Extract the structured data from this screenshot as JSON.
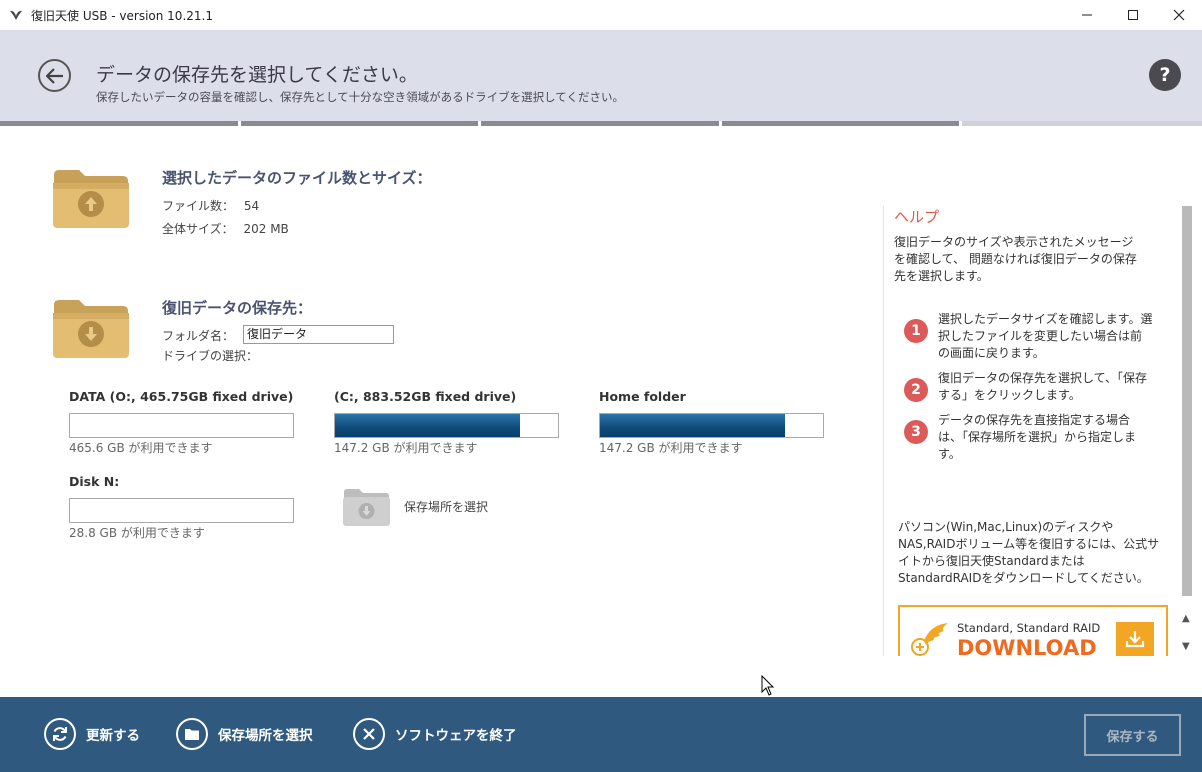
{
  "window": {
    "title": "復旧天使 USB - version 10.21.1"
  },
  "header": {
    "title": "データの保存先を選択してください。",
    "subtitle": "保存したいデータの容量を確認し、保存先として十分な空き領域があるドライブを選択してください。",
    "help_label": "?"
  },
  "selected": {
    "title": "選択したデータのファイル数とサイズ：",
    "file_count_label": "ファイル数：",
    "file_count_value": "54",
    "total_size_label": "全体サイズ：",
    "total_size_value": "202 MB"
  },
  "destination": {
    "title": "復旧データの保存先：",
    "folder_label": "フォルダ名：",
    "folder_value": "復旧データ",
    "drive_label": "ドライブの選択："
  },
  "drives": [
    {
      "name": "DATA (O:, 465.75GB fixed drive)",
      "used_fraction": 0.0,
      "free": "465.6 GB が利用できます"
    },
    {
      "name": " (C:, 883.52GB fixed drive)",
      "used_fraction": 0.83,
      "free": "147.2 GB が利用できます"
    },
    {
      "name": "Home folder",
      "used_fraction": 0.83,
      "free": "147.2 GB が利用できます"
    },
    {
      "name": "Disk N:",
      "used_fraction": 0.0,
      "free": "28.8 GB が利用できます"
    }
  ],
  "choose_location": {
    "label": "保存場所を選択"
  },
  "help": {
    "title": "ヘルプ",
    "intro": "復旧データのサイズや表示されたメッセージを確認して、 問題なければ復旧データの保存先を選択します。",
    "steps": [
      {
        "num": "1",
        "text": "選択したデータサイズを確認します。選択したファイルを変更したい場合は前の画面に戻ります。"
      },
      {
        "num": "2",
        "text": "復旧データの保存先を選択して、「保存する」をクリックします。"
      },
      {
        "num": "3",
        "text": "データの保存先を直接指定する場合は、「保存場所を選択」から指定します。"
      }
    ],
    "note": "パソコン(Win,Mac,Linux)のディスクやNAS,RAIDボリューム等を復旧するには、公式サイトから復旧天使StandardまたはStandardRAIDをダウンロードしてください。",
    "banner_line1": "Standard, Standard RAID",
    "banner_line2": "DOWNLOAD"
  },
  "footer": {
    "refresh_label": "更新する",
    "choose_label": "保存場所を選択",
    "exit_label": "ソフトウェアを終了",
    "save_label": "保存する"
  },
  "colors": {
    "accent": "#30597f",
    "help_red": "#dc5a5a",
    "download_orange": "#ef6a1f",
    "drive_fill": "#0d4a7a"
  }
}
